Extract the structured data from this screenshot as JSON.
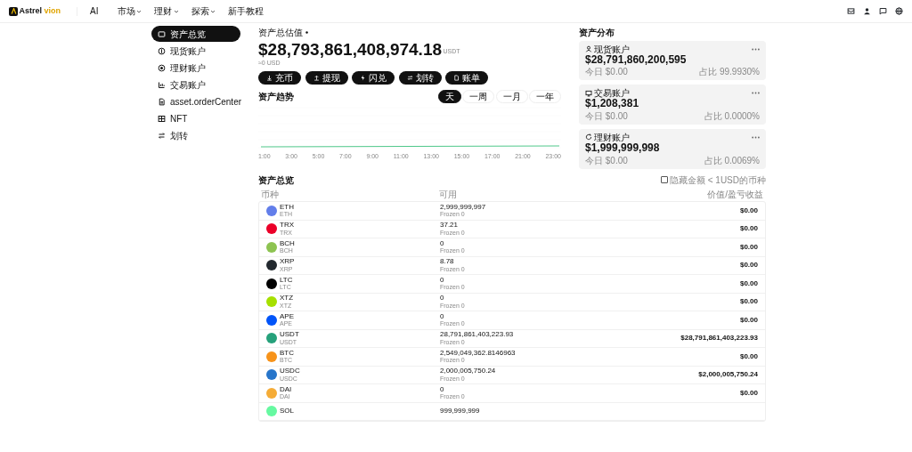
{
  "header": {
    "logo": {
      "brand": "Astrel",
      "accent": "vion"
    },
    "nav": [
      {
        "label": "AI",
        "dropdown": false
      },
      {
        "label": "市场",
        "dropdown": true
      },
      {
        "label": "理财",
        "dropdown": true
      },
      {
        "label": "探索",
        "dropdown": true
      },
      {
        "label": "新手教程",
        "dropdown": false
      }
    ]
  },
  "sidebar": {
    "items": [
      {
        "label": "资产总览",
        "selected": true
      },
      {
        "label": "现货账户",
        "selected": false
      },
      {
        "label": "理财账户",
        "selected": false
      },
      {
        "label": "交易账户",
        "selected": false
      },
      {
        "label": "asset.orderCenter",
        "selected": false
      },
      {
        "label": "NFT",
        "selected": false
      },
      {
        "label": "划转",
        "selected": false
      }
    ]
  },
  "overview": {
    "title": "资产总估值",
    "amount": "$28,793,861,408,974.18",
    "unit": "USDT",
    "approx": "≈0 USD",
    "buttons": [
      "充币",
      "提现",
      "闪兑",
      "划转",
      "账单"
    ]
  },
  "trend": {
    "title": "资产趋势",
    "ranges": [
      {
        "label": "天",
        "selected": true
      },
      {
        "label": "一周",
        "selected": false
      },
      {
        "label": "一月",
        "selected": false
      },
      {
        "label": "一年",
        "selected": false
      }
    ],
    "x_labels": [
      "1:00",
      "3:00",
      "5:00",
      "7:00",
      "9:00",
      "11:00",
      "13:00",
      "15:00",
      "17:00",
      "21:00",
      "23:00"
    ]
  },
  "distribution": {
    "title": "资产分布",
    "accounts": [
      {
        "name": "现货账户",
        "amount": "$28,791,860,200,595",
        "today": "今日 $0.00",
        "share": "占比 99.9930%"
      },
      {
        "name": "交易账户",
        "amount": "$1,208,381",
        "today": "今日 $0.00",
        "share": "占比 0.0000%"
      },
      {
        "name": "理财账户",
        "amount": "$1,999,999,998",
        "today": "今日 $0.00",
        "share": "占比 0.0069%"
      }
    ]
  },
  "assets": {
    "title": "资产总览",
    "hide_small": {
      "label": "隐藏金额 < 1USD的币种",
      "checked": false
    },
    "columns": [
      "币种",
      "可用",
      "价值/盈亏收益"
    ],
    "rows": [
      {
        "symbol": "ETH",
        "sub": "ETH",
        "available": "2,999,999,997",
        "frozen": "Frozen 0",
        "value": "$0.00",
        "color": "#627eea"
      },
      {
        "symbol": "TRX",
        "sub": "TRX",
        "available": "37.21",
        "frozen": "Frozen 0",
        "value": "$0.00",
        "color": "#eb0029"
      },
      {
        "symbol": "BCH",
        "sub": "BCH",
        "available": "0",
        "frozen": "Frozen 0",
        "value": "$0.00",
        "color": "#8dc351"
      },
      {
        "symbol": "XRP",
        "sub": "XRP",
        "available": "8.78",
        "frozen": "Frozen 0",
        "value": "$0.00",
        "color": "#23292f"
      },
      {
        "symbol": "LTC",
        "sub": "LTC",
        "available": "0",
        "frozen": "Frozen 0",
        "value": "$0.00",
        "color": "#000000"
      },
      {
        "symbol": "XTZ",
        "sub": "XTZ",
        "available": "0",
        "frozen": "Frozen 0",
        "value": "$0.00",
        "color": "#a6e000"
      },
      {
        "symbol": "APE",
        "sub": "APE",
        "available": "0",
        "frozen": "Frozen 0",
        "value": "$0.00",
        "color": "#0054f9"
      },
      {
        "symbol": "USDT",
        "sub": "USDT",
        "available": "28,791,861,403,223.93",
        "frozen": "Frozen 0",
        "value": "$28,791,861,403,223.93",
        "color": "#26a17b"
      },
      {
        "symbol": "BTC",
        "sub": "BTC",
        "available": "2,549,049,362.8146963",
        "frozen": "Frozen 0",
        "value": "$0.00",
        "color": "#f7931a"
      },
      {
        "symbol": "USDC",
        "sub": "USDC",
        "available": "2,000,005,750.24",
        "frozen": "Frozen 0",
        "value": "$2,000,005,750.24",
        "color": "#2775ca"
      },
      {
        "symbol": "DAI",
        "sub": "DAI",
        "available": "0",
        "frozen": "Frozen 0",
        "value": "$0.00",
        "color": "#f5ac37"
      },
      {
        "symbol": "SOL",
        "available": "999,999,999",
        "color": "#66f9a1"
      }
    ]
  }
}
